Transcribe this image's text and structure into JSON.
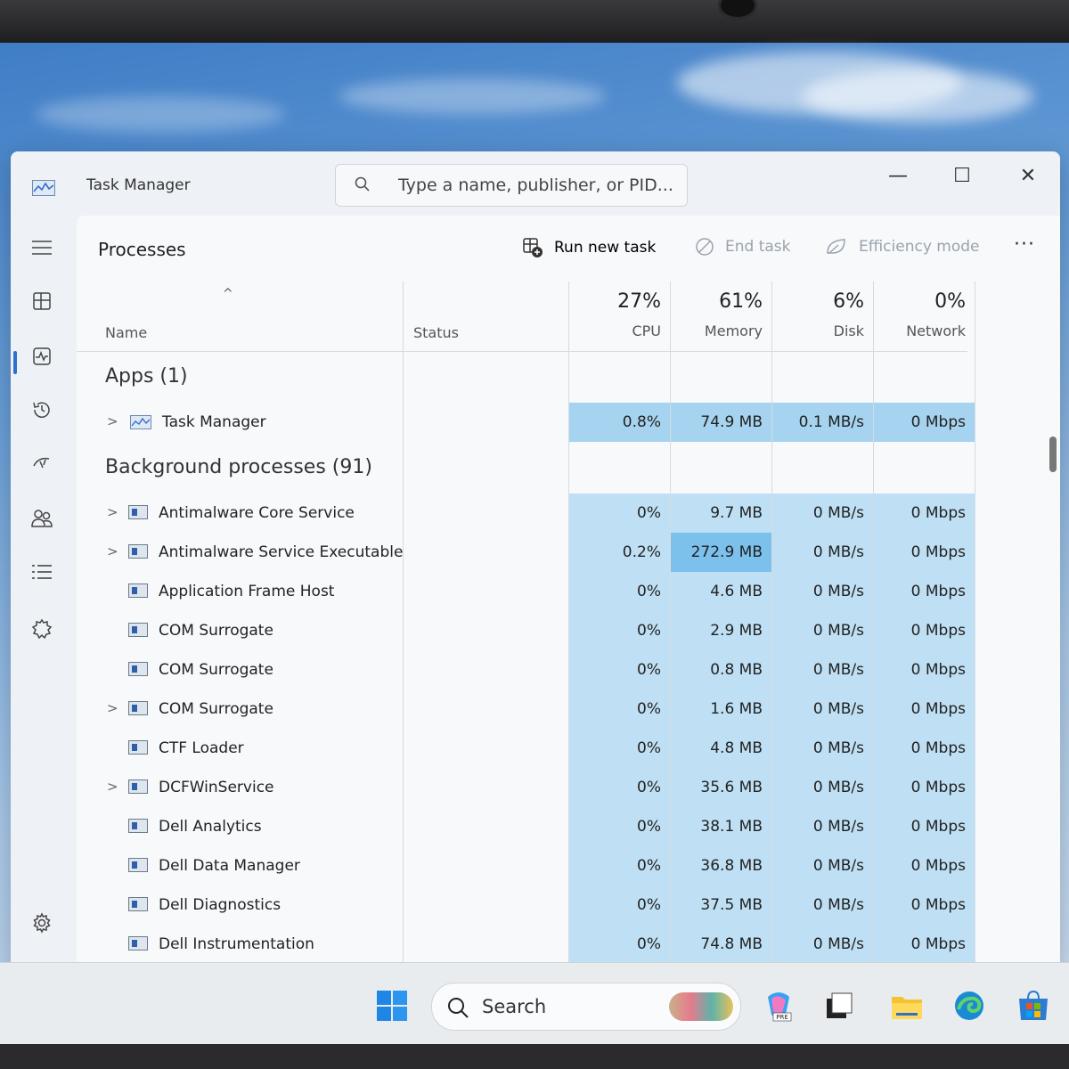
{
  "window": {
    "title": "Task Manager",
    "search_placeholder": "Type a name, publisher, or PID...",
    "controls": {
      "minimize": "—",
      "maximize": "☐",
      "close": "✕"
    }
  },
  "page": {
    "heading": "Processes",
    "toolbar": {
      "run_new_task": "Run new task",
      "end_task": "End task",
      "efficiency_mode": "Efficiency mode",
      "more": "···"
    }
  },
  "columns": {
    "name": "Name",
    "status": "Status",
    "cpu": {
      "label": "CPU",
      "pct": "27%"
    },
    "memory": {
      "label": "Memory",
      "pct": "61%"
    },
    "disk": {
      "label": "Disk",
      "pct": "6%"
    },
    "network": {
      "label": "Network",
      "pct": "0%"
    }
  },
  "groups": {
    "apps": "Apps (1)",
    "background": "Background processes (91)"
  },
  "apps": [
    {
      "name": "Task Manager",
      "expandable": true,
      "cpu": "0.8%",
      "memory": "74.9 MB",
      "disk": "0.1 MB/s",
      "network": "0 Mbps"
    }
  ],
  "processes": [
    {
      "name": "Antimalware Core Service",
      "expandable": true,
      "cpu": "0%",
      "memory": "9.7 MB",
      "disk": "0 MB/s",
      "network": "0 Mbps"
    },
    {
      "name": "Antimalware Service Executable",
      "expandable": true,
      "cpu": "0.2%",
      "memory": "272.9 MB",
      "disk": "0 MB/s",
      "network": "0 Mbps"
    },
    {
      "name": "Application Frame Host",
      "expandable": false,
      "cpu": "0%",
      "memory": "4.6 MB",
      "disk": "0 MB/s",
      "network": "0 Mbps"
    },
    {
      "name": "COM Surrogate",
      "expandable": false,
      "cpu": "0%",
      "memory": "2.9 MB",
      "disk": "0 MB/s",
      "network": "0 Mbps"
    },
    {
      "name": "COM Surrogate",
      "expandable": false,
      "cpu": "0%",
      "memory": "0.8 MB",
      "disk": "0 MB/s",
      "network": "0 Mbps"
    },
    {
      "name": "COM Surrogate",
      "expandable": true,
      "cpu": "0%",
      "memory": "1.6 MB",
      "disk": "0 MB/s",
      "network": "0 Mbps"
    },
    {
      "name": "CTF Loader",
      "expandable": false,
      "cpu": "0%",
      "memory": "4.8 MB",
      "disk": "0 MB/s",
      "network": "0 Mbps"
    },
    {
      "name": "DCFWinService",
      "expandable": true,
      "cpu": "0%",
      "memory": "35.6 MB",
      "disk": "0 MB/s",
      "network": "0 Mbps"
    },
    {
      "name": "Dell Analytics",
      "expandable": false,
      "cpu": "0%",
      "memory": "38.1 MB",
      "disk": "0 MB/s",
      "network": "0 Mbps"
    },
    {
      "name": "Dell Data Manager",
      "expandable": false,
      "cpu": "0%",
      "memory": "36.8 MB",
      "disk": "0 MB/s",
      "network": "0 Mbps"
    },
    {
      "name": "Dell Diagnostics",
      "expandable": false,
      "cpu": "0%",
      "memory": "37.5 MB",
      "disk": "0 MB/s",
      "network": "0 Mbps"
    },
    {
      "name": "Dell Instrumentation",
      "expandable": false,
      "cpu": "0%",
      "memory": "74.8 MB",
      "disk": "0 MB/s",
      "network": "0 Mbps"
    }
  ],
  "heat_colors": {
    "light": "#bfe0f4",
    "medium": "#a6d3ef",
    "strong": "#7cc0ec"
  },
  "taskbar": {
    "search_label": "Search"
  },
  "icons": {
    "app": "task-manager-icon",
    "search": "search-icon",
    "hamburger": "hamburger-icon",
    "processes": "processes-icon",
    "performance": "performance-icon",
    "history": "history-icon",
    "startup": "startup-icon",
    "users": "users-icon",
    "details": "details-icon",
    "services": "services-icon",
    "settings": "gear-icon"
  }
}
